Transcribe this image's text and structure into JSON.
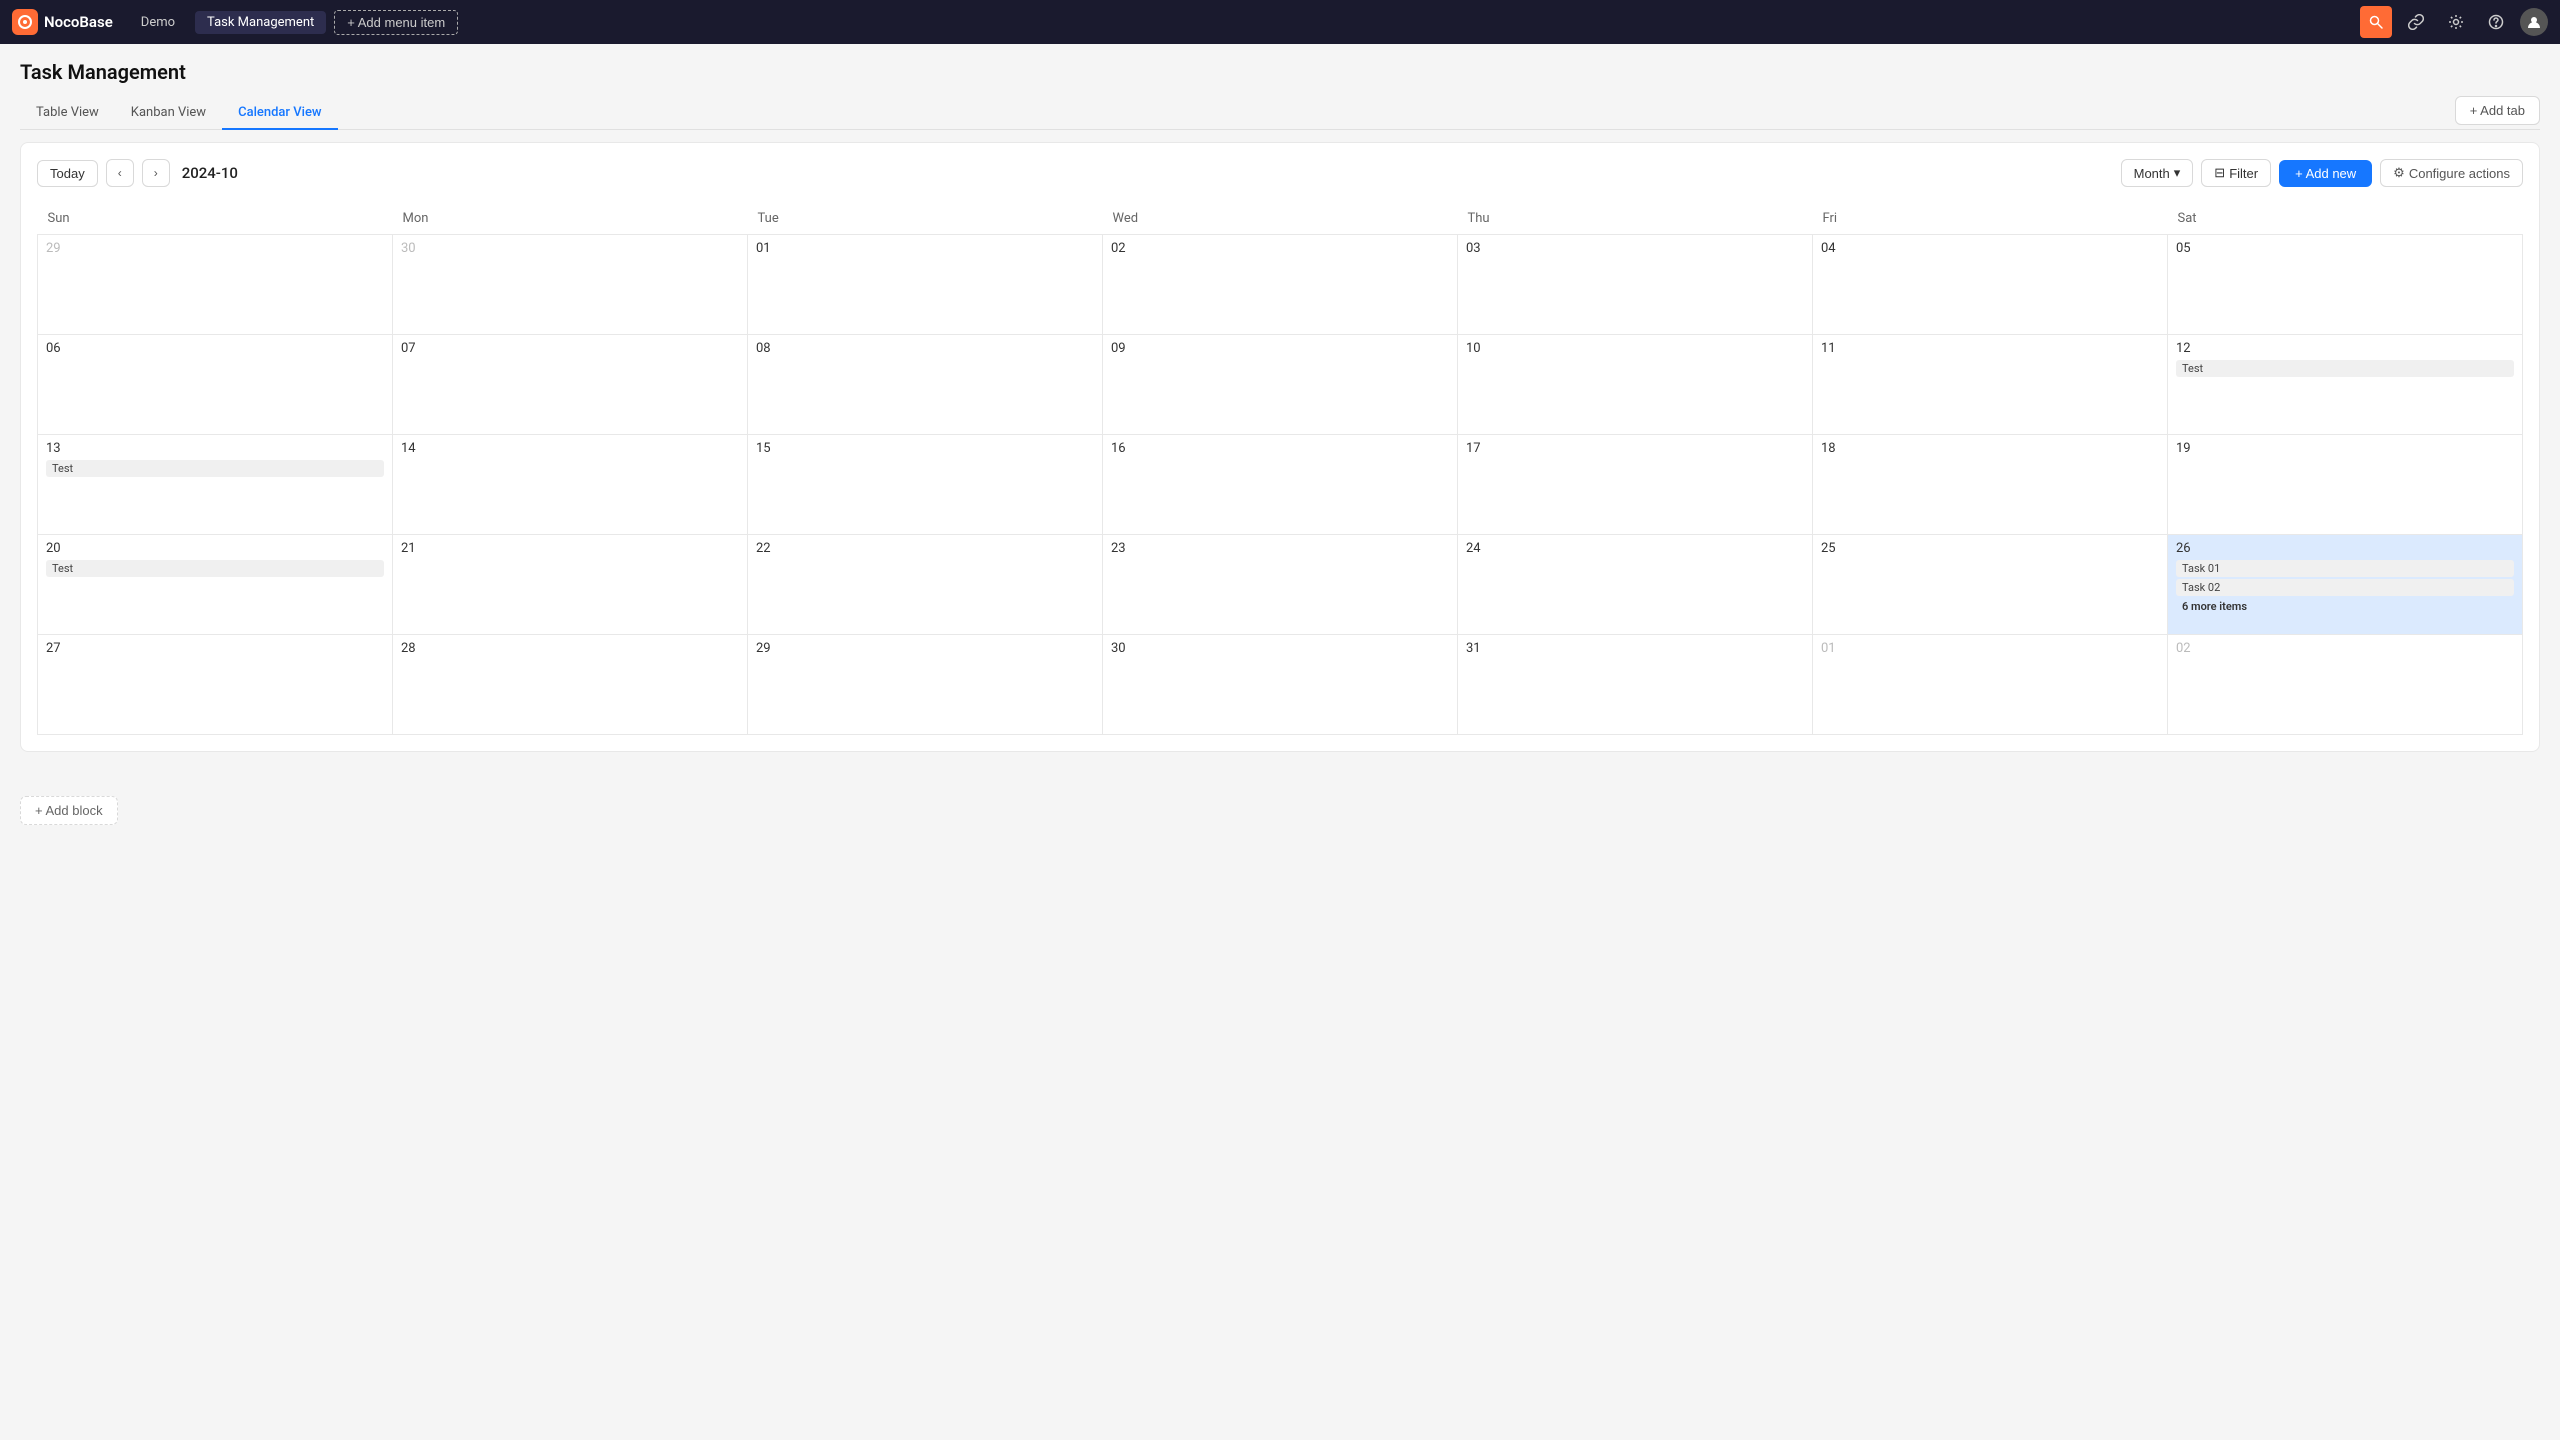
{
  "app": {
    "logo_text": "NocoBase",
    "logo_icon": "N"
  },
  "topnav": {
    "tabs": [
      {
        "label": "Demo",
        "active": false
      },
      {
        "label": "Task Management",
        "active": true
      }
    ],
    "add_menu_label": "+ Add menu item",
    "icons": [
      "search",
      "link",
      "settings",
      "help",
      "user"
    ]
  },
  "page": {
    "title": "Task Management"
  },
  "view_tabs": [
    {
      "label": "Table View",
      "active": false
    },
    {
      "label": "Kanban View",
      "active": false
    },
    {
      "label": "Calendar View",
      "active": true
    }
  ],
  "add_tab_label": "+ Add tab",
  "calendar": {
    "today_label": "Today",
    "current_date": "2024-10",
    "month_label": "Month",
    "filter_label": "Filter",
    "add_new_label": "+ Add new",
    "configure_label": "Configure actions",
    "days_of_week": [
      "Sun",
      "Mon",
      "Tue",
      "Wed",
      "Thu",
      "Fri",
      "Sat"
    ],
    "weeks": [
      [
        {
          "date": "29",
          "outside": true,
          "events": []
        },
        {
          "date": "30",
          "outside": true,
          "events": []
        },
        {
          "date": "01",
          "events": []
        },
        {
          "date": "02",
          "events": []
        },
        {
          "date": "03",
          "events": []
        },
        {
          "date": "04",
          "events": []
        },
        {
          "date": "05",
          "events": []
        }
      ],
      [
        {
          "date": "06",
          "events": []
        },
        {
          "date": "07",
          "events": []
        },
        {
          "date": "08",
          "events": []
        },
        {
          "date": "09",
          "events": []
        },
        {
          "date": "10",
          "events": []
        },
        {
          "date": "11",
          "events": []
        },
        {
          "date": "12",
          "events": [
            {
              "label": "Test"
            }
          ]
        }
      ],
      [
        {
          "date": "13",
          "events": [
            {
              "label": "Test"
            }
          ]
        },
        {
          "date": "14",
          "events": []
        },
        {
          "date": "15",
          "events": []
        },
        {
          "date": "16",
          "events": []
        },
        {
          "date": "17",
          "events": []
        },
        {
          "date": "18",
          "events": []
        },
        {
          "date": "19",
          "events": []
        }
      ],
      [
        {
          "date": "20",
          "events": [
            {
              "label": "Test"
            }
          ]
        },
        {
          "date": "21",
          "events": []
        },
        {
          "date": "22",
          "events": []
        },
        {
          "date": "23",
          "events": []
        },
        {
          "date": "24",
          "events": []
        },
        {
          "date": "25",
          "events": []
        },
        {
          "date": "26",
          "highlighted": true,
          "events": [
            {
              "label": "Task 01"
            },
            {
              "label": "Task 02"
            }
          ],
          "more": "6 more items"
        }
      ],
      [
        {
          "date": "27",
          "events": []
        },
        {
          "date": "28",
          "events": []
        },
        {
          "date": "29",
          "events": []
        },
        {
          "date": "30",
          "events": []
        },
        {
          "date": "31",
          "events": []
        },
        {
          "date": "01",
          "outside": true,
          "events": []
        },
        {
          "date": "02",
          "outside": true,
          "events": []
        }
      ]
    ]
  },
  "add_block_label": "+ Add block"
}
